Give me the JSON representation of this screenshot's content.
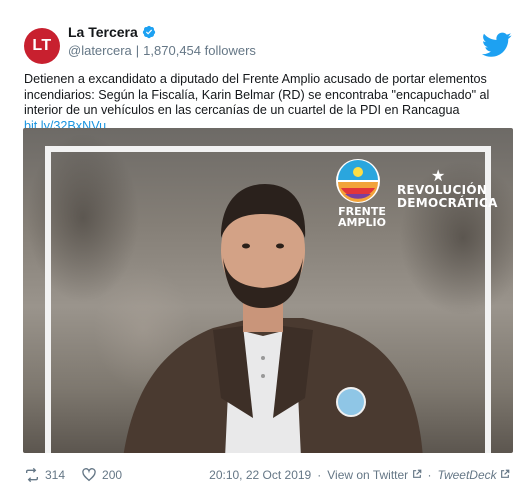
{
  "account": {
    "display_name": "La Tercera",
    "avatar_text": "LT",
    "handle": "@latercera",
    "separator": "|",
    "followers": "1,870,454 followers",
    "verified": true
  },
  "tweet": {
    "text_main": "Detienen a excandidato a diputado del Frente Amplio acusado de portar elementos incendiarios: Según la Fiscalía, Karin Belmar (RD) se encontraba \"encapuchado\" al interior de un vehículos en las cercanías de un cuartel de la PDI en Rancagua",
    "link_text": "bit.ly/32BxNVu"
  },
  "media": {
    "logo_left": "FRENTE\nAMPLIO",
    "logo_left_line1": "FRENTE",
    "logo_left_line2": "AMPLIO",
    "logo_right_line1": "REVOLUCIÓN",
    "logo_right_line2": "DEMOCRÁTICA",
    "star": "★"
  },
  "footer": {
    "retweets": "314",
    "likes": "200",
    "timestamp": "20:10, 22 Oct 2019",
    "view_link": "View on Twitter",
    "separator": "·",
    "source": "TweetDeck"
  },
  "colors": {
    "brand_red": "#c8202f",
    "twitter_blue": "#1da1f2",
    "link_blue": "#1b95e0",
    "muted": "#657786"
  },
  "icons": [
    "verified-badge-icon",
    "twitter-bird-icon",
    "retweet-icon",
    "heart-icon",
    "external-link-icon"
  ]
}
